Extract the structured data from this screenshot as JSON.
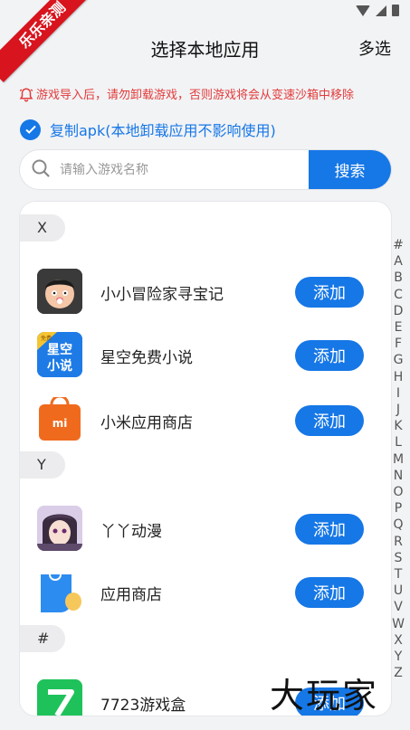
{
  "ribbon": {
    "label": "乐乐亲测"
  },
  "header": {
    "title": "选择本地应用",
    "multi_select": "多选"
  },
  "warning": {
    "text": "游戏导入后，请勿卸载游戏，否则游戏将会从变速沙箱中移除"
  },
  "copy_option": {
    "label": "复制apk(本地卸载应用不影响使用)",
    "checked": true
  },
  "search": {
    "placeholder": "请输入游戏名称",
    "button_label": "搜索"
  },
  "sections": [
    {
      "letter": "X",
      "apps": [
        {
          "name": "小小冒险家寻宝记",
          "button": "添加"
        },
        {
          "name": "星空免费小说",
          "button": "添加",
          "icon_text": "星空\n小说",
          "badge": "免费"
        },
        {
          "name": "小米应用商店",
          "button": "添加",
          "icon_text": "mi"
        }
      ]
    },
    {
      "letter": "Y",
      "apps": [
        {
          "name": "丫丫动漫",
          "button": "添加"
        },
        {
          "name": "应用商店",
          "button": "添加"
        }
      ]
    },
    {
      "letter": "#",
      "apps": [
        {
          "name": "7723游戏盒",
          "button": "添加"
        }
      ]
    }
  ],
  "alphabet_index": [
    "#",
    "A",
    "B",
    "C",
    "D",
    "E",
    "F",
    "G",
    "H",
    "I",
    "J",
    "K",
    "L",
    "M",
    "N",
    "O",
    "P",
    "Q",
    "R",
    "S",
    "T",
    "U",
    "V",
    "W",
    "X",
    "Y",
    "Z"
  ],
  "watermark": {
    "text": "大玩家"
  },
  "colors": {
    "accent": "#1677e6",
    "warning": "#e23b3b",
    "ribbon": "#d8141e"
  }
}
